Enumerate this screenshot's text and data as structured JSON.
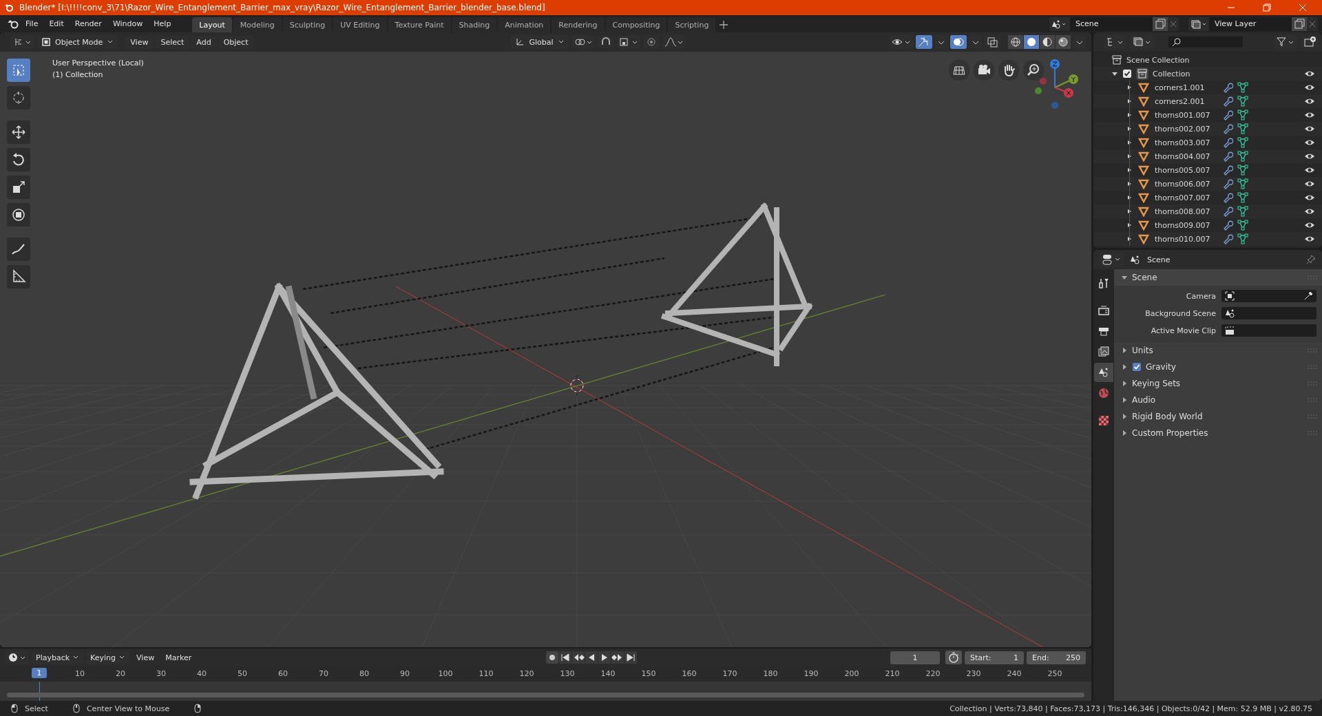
{
  "window": {
    "title": "Blender* [I:\\!!!!conv_3\\71\\Razor_Wire_Entanglement_Barrier_max_vray\\Razor_Wire_Entanglement_Barrier_blender_base.blend]"
  },
  "menus": [
    "File",
    "Edit",
    "Render",
    "Window",
    "Help"
  ],
  "workspace_tabs": [
    {
      "label": "Layout",
      "selected": true
    },
    {
      "label": "Modeling",
      "selected": false
    },
    {
      "label": "Sculpting",
      "selected": false
    },
    {
      "label": "UV Editing",
      "selected": false
    },
    {
      "label": "Texture Paint",
      "selected": false
    },
    {
      "label": "Shading",
      "selected": false
    },
    {
      "label": "Animation",
      "selected": false
    },
    {
      "label": "Rendering",
      "selected": false
    },
    {
      "label": "Compositing",
      "selected": false
    },
    {
      "label": "Scripting",
      "selected": false
    }
  ],
  "scene_field": {
    "value": "Scene"
  },
  "view_layer_field": {
    "value": "View Layer"
  },
  "viewport": {
    "mode": "Object Mode",
    "menus": [
      "View",
      "Select",
      "Add",
      "Object"
    ],
    "orientation": "Global",
    "toggles": [
      {
        "kind": "gizmo",
        "on": true
      },
      {
        "kind": "overlay",
        "on": true
      },
      {
        "kind": "xray",
        "on": false
      }
    ],
    "shading": [
      {
        "kind": "wireframe",
        "selected": false
      },
      {
        "kind": "solid",
        "selected": true
      },
      {
        "kind": "material",
        "selected": false
      },
      {
        "kind": "rendered",
        "selected": false
      }
    ],
    "overlay_text": [
      "User Perspective (Local)",
      "(1) Collection"
    ],
    "tools": [
      {
        "kind": "select",
        "selected": true
      },
      {
        "kind": "cursor",
        "selected": false
      },
      {
        "kind": "move",
        "selected": false
      },
      {
        "kind": "rotate",
        "selected": false
      },
      {
        "kind": "scale",
        "selected": false
      },
      {
        "kind": "transform",
        "selected": false
      },
      {
        "kind": "annotate",
        "selected": false
      },
      {
        "kind": "measure",
        "selected": false
      }
    ]
  },
  "outliner": {
    "root": "Scene Collection",
    "collection": {
      "name": "Collection",
      "checked": true,
      "expanded": true,
      "children": [
        {
          "name": "corners1.001",
          "expanded": false
        },
        {
          "name": "corners2.001",
          "expanded": false
        },
        {
          "name": "thorns001.007",
          "expanded": false
        },
        {
          "name": "thorns002.007",
          "expanded": false
        },
        {
          "name": "thorns003.007",
          "expanded": false
        },
        {
          "name": "thorns004.007",
          "expanded": false
        },
        {
          "name": "thorns005.007",
          "expanded": false
        },
        {
          "name": "thorns006.007",
          "expanded": false
        },
        {
          "name": "thorns007.007",
          "expanded": false
        },
        {
          "name": "thorns008.007",
          "expanded": false
        },
        {
          "name": "thorns009.007",
          "expanded": false
        },
        {
          "name": "thorns010.007",
          "expanded": false
        }
      ]
    }
  },
  "properties": {
    "context": "Scene",
    "tabs": [
      {
        "kind": "tool",
        "selected": false
      },
      {
        "kind": "render",
        "selected": false
      },
      {
        "kind": "output",
        "selected": false
      },
      {
        "kind": "view_layer",
        "selected": false
      },
      {
        "kind": "scene",
        "selected": true
      },
      {
        "kind": "world",
        "selected": false
      },
      {
        "kind": "texture",
        "selected": false
      }
    ],
    "panel": {
      "title": "Scene",
      "expanded": true,
      "fields": [
        {
          "label": "Camera",
          "kind": "camera"
        },
        {
          "label": "Background Scene",
          "kind": "scene"
        },
        {
          "label": "Active Movie Clip",
          "kind": "clip"
        }
      ]
    },
    "subpanels": [
      {
        "title": "Units",
        "expanded": false
      },
      {
        "title": "Gravity",
        "expanded": false,
        "checked": true
      },
      {
        "title": "Keying Sets",
        "expanded": false
      },
      {
        "title": "Audio",
        "expanded": false
      },
      {
        "title": "Rigid Body World",
        "expanded": false
      },
      {
        "title": "Custom Properties",
        "expanded": false
      }
    ]
  },
  "timeline": {
    "menus": [
      "Playback",
      "Keying",
      "View",
      "Marker"
    ],
    "current_frame": "1",
    "start_label": "Start:",
    "start": "1",
    "end_label": "End:",
    "end": "250",
    "playhead": "1",
    "ticks": [
      "10",
      "20",
      "30",
      "40",
      "50",
      "60",
      "70",
      "80",
      "90",
      "100",
      "110",
      "120",
      "130",
      "140",
      "150",
      "160",
      "170",
      "180",
      "190",
      "200",
      "210",
      "220",
      "230",
      "240",
      "250"
    ]
  },
  "status_bar": {
    "hints": [
      "Select",
      "Center View to Mouse"
    ],
    "stats": "Collection | Verts:73,840 | Faces:73,173 | Tris:146,346 | Objects:0/42 | Mem: 52.9 MB | v2.80.75"
  }
}
